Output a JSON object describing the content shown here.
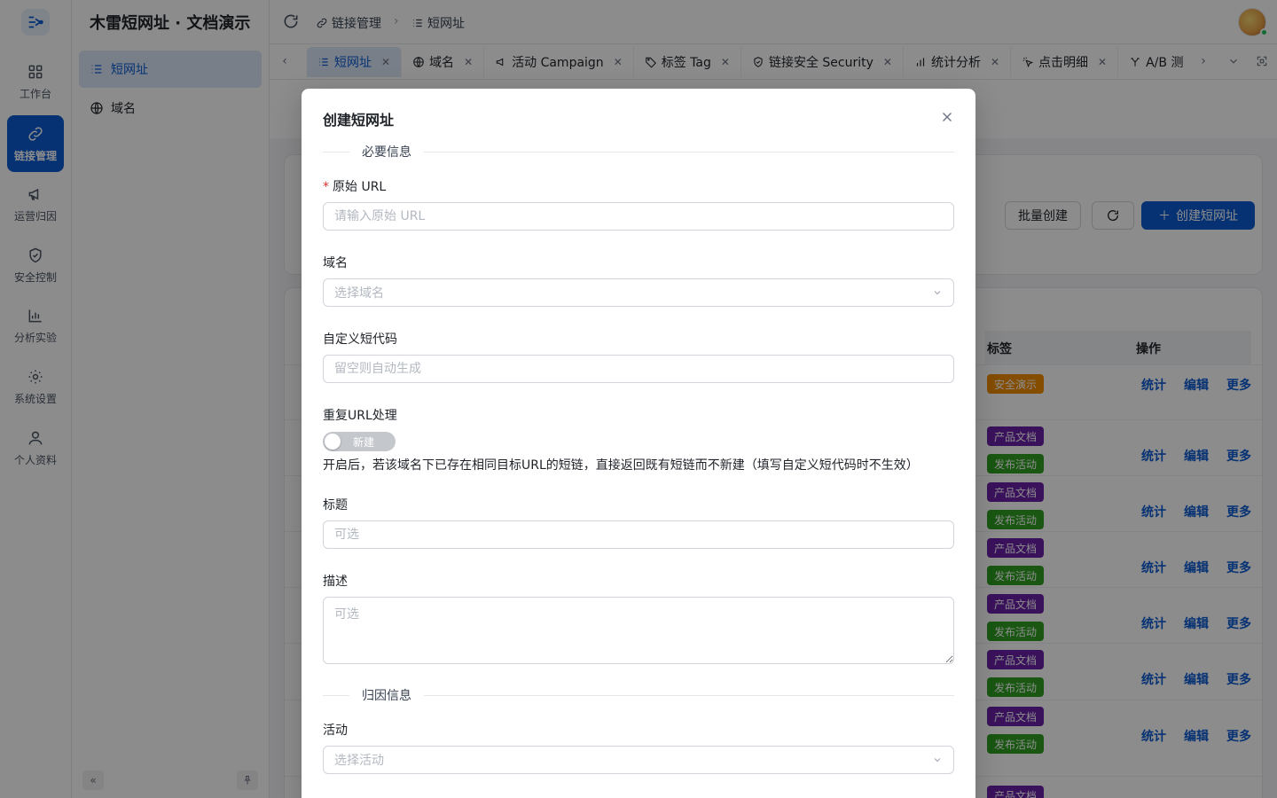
{
  "app": {
    "title": "木雷短网址 · 文档演示"
  },
  "rail": {
    "items": [
      {
        "label": "工作台",
        "icon": "dashboard-icon"
      },
      {
        "label": "链接管理",
        "icon": "link-icon"
      },
      {
        "label": "运营归因",
        "icon": "megaphone-icon"
      },
      {
        "label": "安全控制",
        "icon": "shield-icon"
      },
      {
        "label": "分析实验",
        "icon": "bar-chart-icon"
      },
      {
        "label": "系统设置",
        "icon": "gear-icon"
      },
      {
        "label": "个人资料",
        "icon": "user-icon"
      }
    ],
    "active_index": 1
  },
  "sidebar": {
    "items": [
      {
        "label": "短网址",
        "icon": "list-icon"
      },
      {
        "label": "域名",
        "icon": "globe-icon"
      }
    ],
    "collapse_icon": "double-chevron-left-icon",
    "pin_icon": "pin-icon"
  },
  "header": {
    "breadcrumb": [
      {
        "label": "链接管理",
        "icon": "link-icon"
      },
      {
        "label": "短网址",
        "icon": "list-icon"
      }
    ]
  },
  "tabs": [
    {
      "label": "短网址",
      "icon": "list-icon"
    },
    {
      "label": "域名",
      "icon": "globe-icon"
    },
    {
      "label": "活动 Campaign",
      "icon": "megaphone-icon"
    },
    {
      "label": "标签 Tag",
      "icon": "tag-icon"
    },
    {
      "label": "链接安全 Security",
      "icon": "shield-icon"
    },
    {
      "label": "统计分析",
      "icon": "bar-chart-icon"
    },
    {
      "label": "点击明细",
      "icon": "click-icon"
    },
    {
      "label": "A/B 测",
      "icon": "split-icon"
    }
  ],
  "background": {
    "buttons": {
      "batch": "批量创建",
      "create": "创建短网址"
    },
    "table": {
      "headers": [
        "标签",
        "操作"
      ],
      "actions": [
        "统计",
        "编辑",
        "更多"
      ],
      "tags": {
        "security_demo": "安全演示",
        "product_docs": "产品文档",
        "release_event": "发布活动"
      },
      "colors": {
        "orange": "#f08c00",
        "purple": "#6b21a8",
        "green": "#2f9e22"
      }
    }
  },
  "modal": {
    "title": "创建短网址",
    "section_required": "必要信息",
    "section_attribution": "归因信息",
    "fields": {
      "url": {
        "label": "原始 URL",
        "placeholder": "请输入原始 URL",
        "required": true
      },
      "domain": {
        "label": "域名",
        "placeholder": "选择域名"
      },
      "code": {
        "label": "自定义短代码",
        "placeholder": "留空则自动生成"
      },
      "dedup": {
        "label": "重复URL处理",
        "toggle_text": "新建",
        "enabled": false,
        "hint": "开启后，若该域名下已存在相同目标URL的短链，直接返回既有短链而不新建（填写自定义短代码时不生效）"
      },
      "title": {
        "label": "标题",
        "placeholder": "可选"
      },
      "desc": {
        "label": "描述",
        "placeholder": "可选"
      },
      "campaign": {
        "label": "活动",
        "placeholder": "选择活动"
      }
    }
  },
  "colors": {
    "accent": "#0b5bd3",
    "accent_light": "#dbe8f7"
  }
}
